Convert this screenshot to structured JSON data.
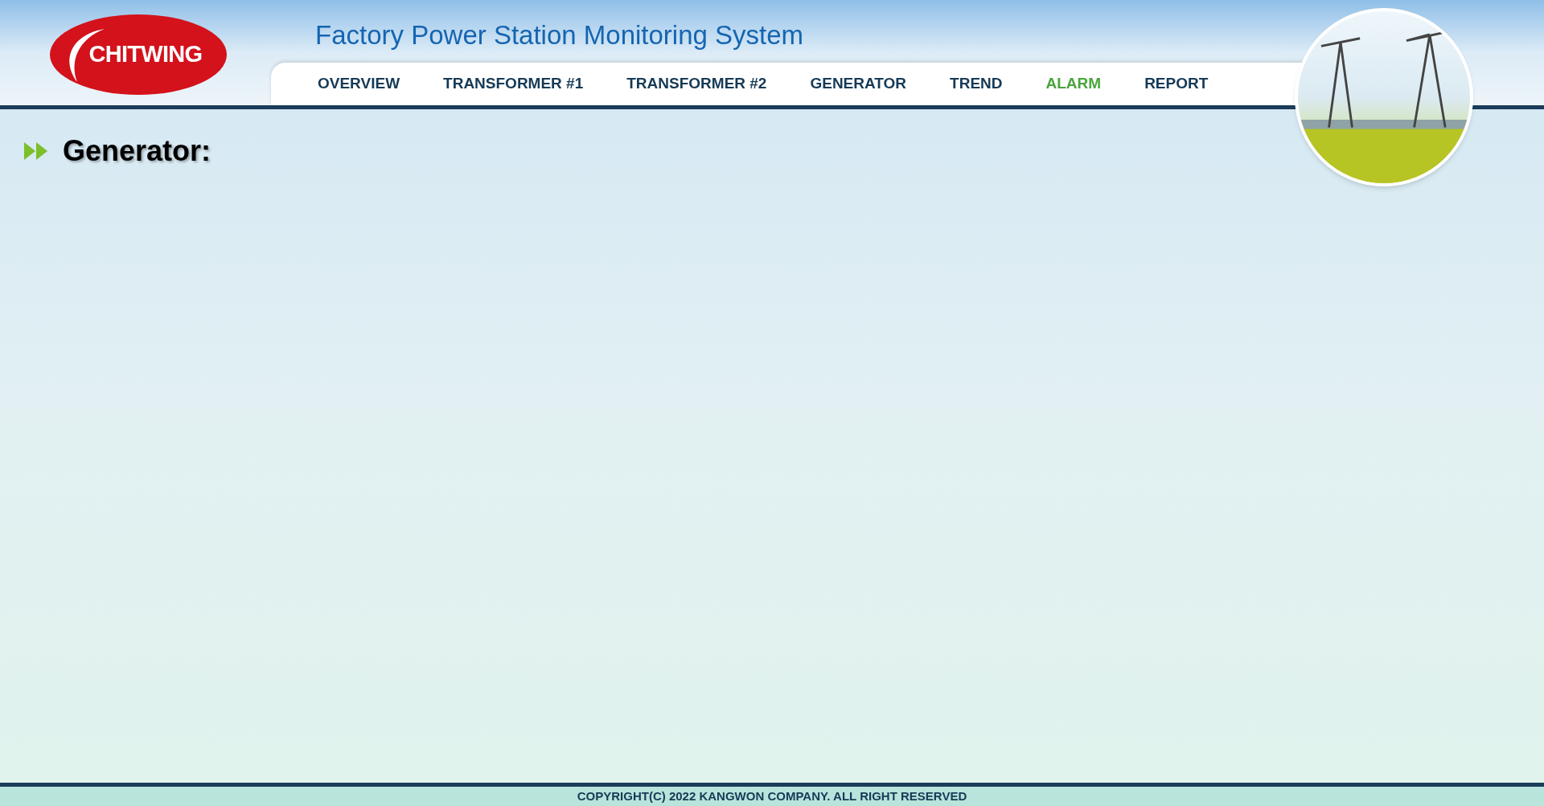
{
  "logo": {
    "text": "CHITWING"
  },
  "title": "Factory Power Station Monitoring System",
  "nav": [
    {
      "label": "OVERVIEW",
      "selected": false
    },
    {
      "label": "TRANSFORMER #1",
      "selected": false
    },
    {
      "label": "TRANSFORMER #2",
      "selected": false
    },
    {
      "label": "GENERATOR",
      "selected": false
    },
    {
      "label": "TREND",
      "selected": false
    },
    {
      "label": "ALARM",
      "selected": true
    },
    {
      "label": "REPORT",
      "selected": false
    }
  ],
  "page_heading": "Generator:",
  "footer": "COPYRIGHT(C) 2022 KANGWON COMPANY. ALL RIGHT RESERVED"
}
